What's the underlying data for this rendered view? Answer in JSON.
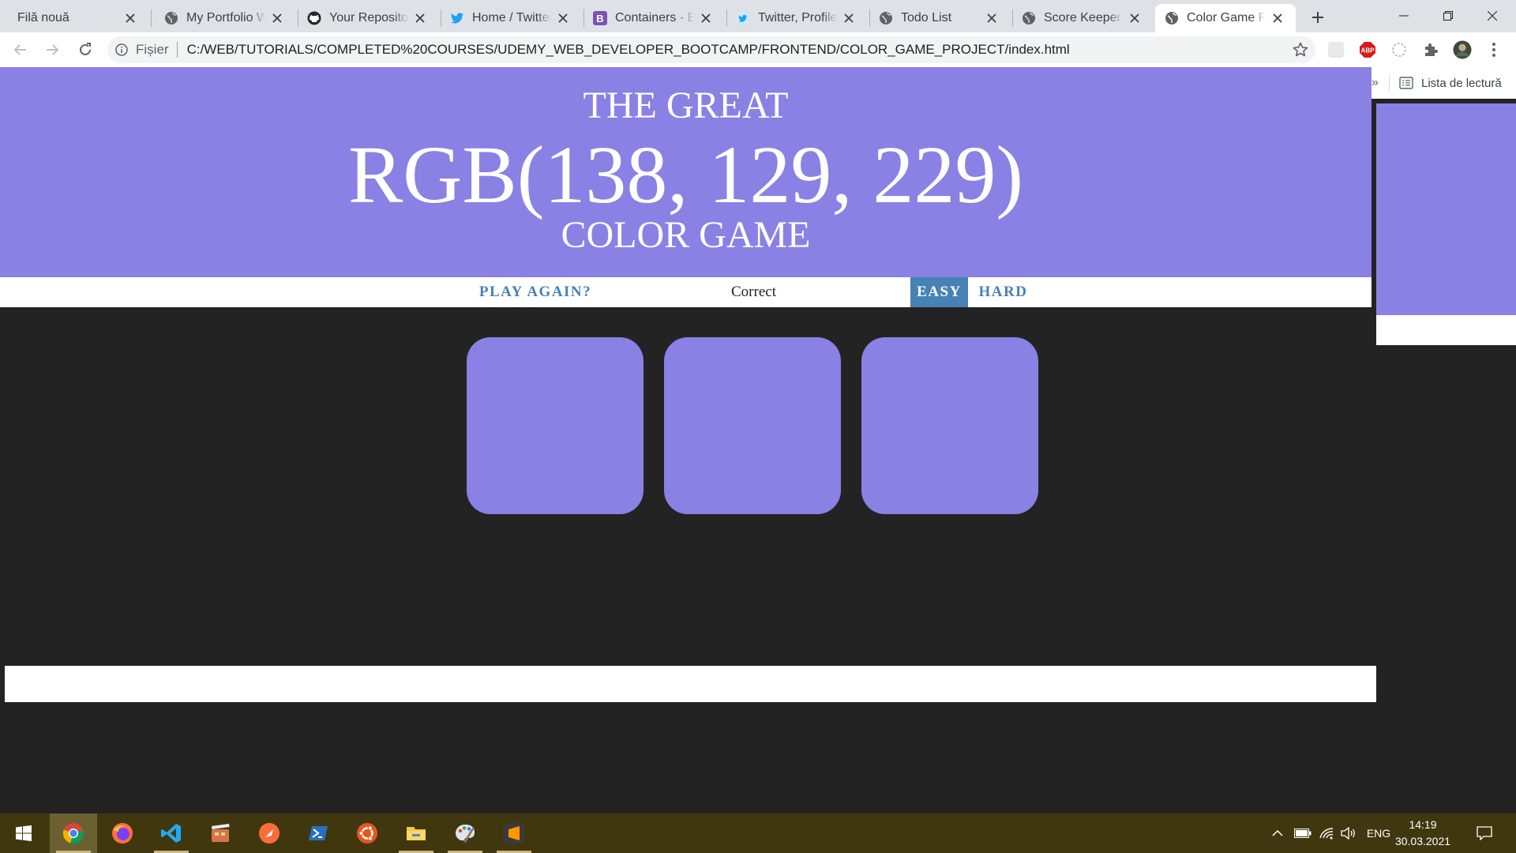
{
  "browser": {
    "tabs": [
      {
        "title": "Filă nouă",
        "favicon": "none"
      },
      {
        "title": "My Portfolio Website",
        "favicon": "globe-icon"
      },
      {
        "title": "Your Repositories",
        "favicon": "github-icon"
      },
      {
        "title": "Home / Twitter",
        "favicon": "twitter-icon"
      },
      {
        "title": "Containers · Bootstrap",
        "favicon": "bootstrap-icon"
      },
      {
        "title": "Twitter, Profile",
        "favicon": "twitter-circle-icon"
      },
      {
        "title": "Todo List",
        "favicon": "globe-icon"
      },
      {
        "title": "Score Keeper",
        "favicon": "globe-icon"
      },
      {
        "title": "Color Game Project",
        "favicon": "globe-icon"
      }
    ],
    "active_tab_index": 8,
    "omnibox": {
      "scheme_label": "Fișier",
      "url": "C:/WEB/TUTORIALS/COMPLETED%20COURSES/UDEMY_WEB_DEVELOPER_BOOTCAMP/FRONTEND/COLOR_GAME_PROJECT/index.html"
    },
    "reading_list_label": "Lista de lectură",
    "overflow_chevron": "»"
  },
  "game": {
    "header_line1": "THE GREAT",
    "target_color": "RGB(138, 129, 229)",
    "header_line3": "COLOR GAME",
    "play_again_label": "PLAY AGAIN?",
    "message": "Correct",
    "easy_label": "EASY",
    "hard_label": "HARD",
    "selected_mode": "EASY",
    "square_colors": [
      "#8a81e5",
      "#8a81e5",
      "#8a81e5"
    ],
    "header_color": "#8a81e5",
    "accent_color": "#4682b4",
    "background_color": "#232323"
  },
  "taskbar": {
    "apps": [
      "windows-start-icon",
      "chrome-icon",
      "firefox-icon",
      "vscode-icon",
      "video-editor-icon",
      "postman-icon",
      "powershell-icon",
      "ubuntu-icon",
      "file-explorer-icon",
      "paint-icon",
      "sublime-icon"
    ],
    "language": "ENG",
    "time": "14:19",
    "date": "30.03.2021"
  }
}
